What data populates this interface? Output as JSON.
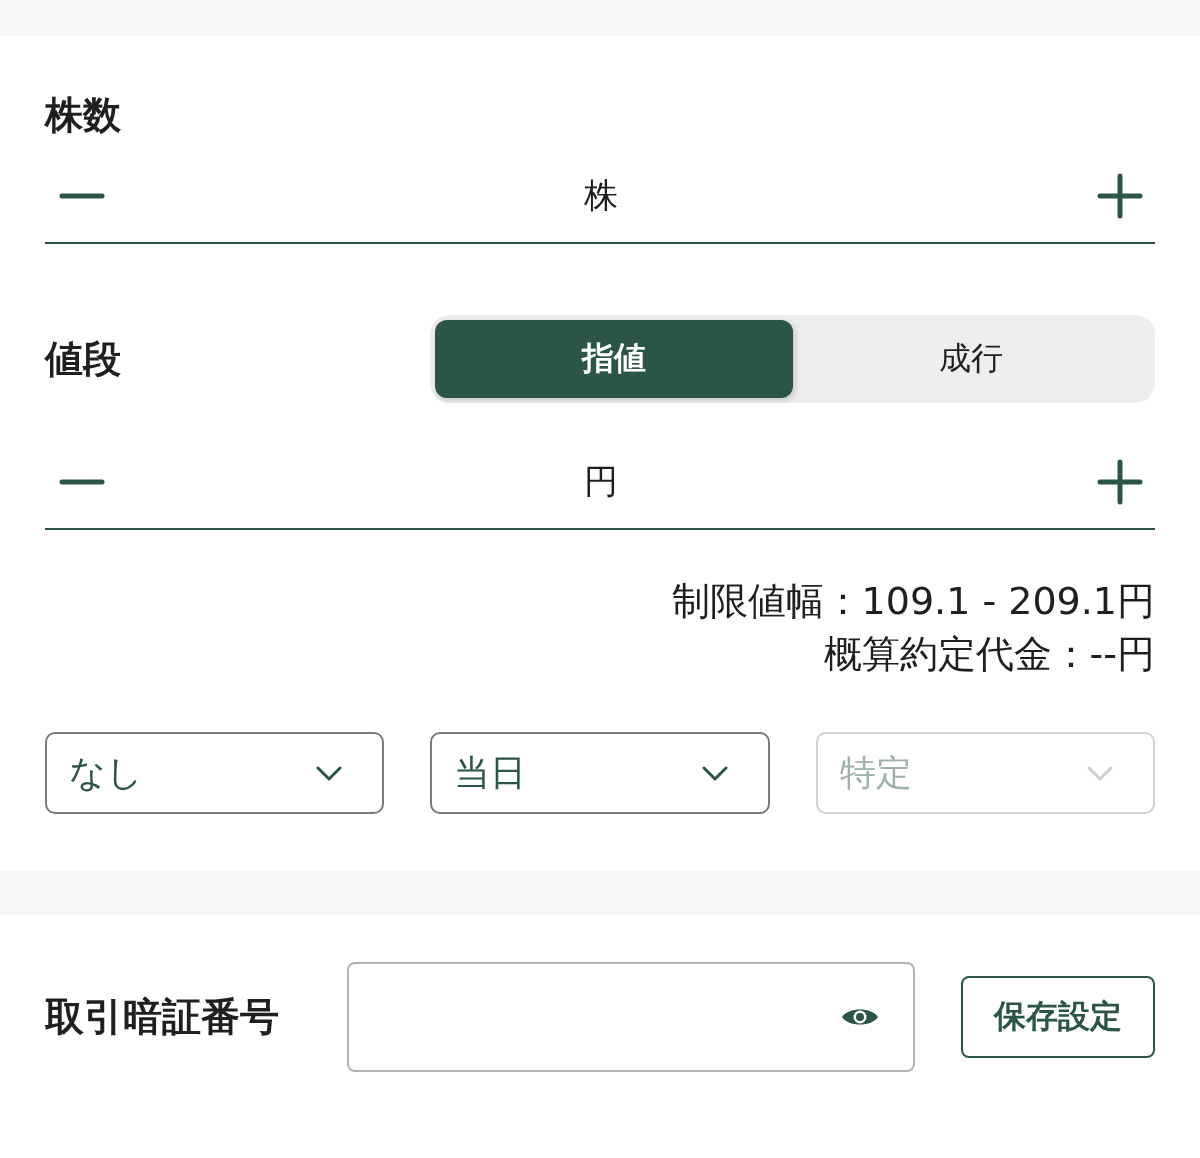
{
  "quantity": {
    "label": "株数",
    "unit": "株"
  },
  "price": {
    "label": "値段",
    "order_types": [
      {
        "label": "指値",
        "selected": true
      },
      {
        "label": "成行",
        "selected": false
      }
    ],
    "unit": "円"
  },
  "price_info": [
    "制限値幅：109.1 - 209.1円",
    "概算約定代金：--円"
  ],
  "dropdowns": [
    {
      "value": "なし",
      "disabled": false
    },
    {
      "value": "当日",
      "disabled": false
    },
    {
      "value": "特定",
      "disabled": true
    }
  ],
  "pin": {
    "label": "取引暗証番号",
    "button": "保存設定"
  }
}
